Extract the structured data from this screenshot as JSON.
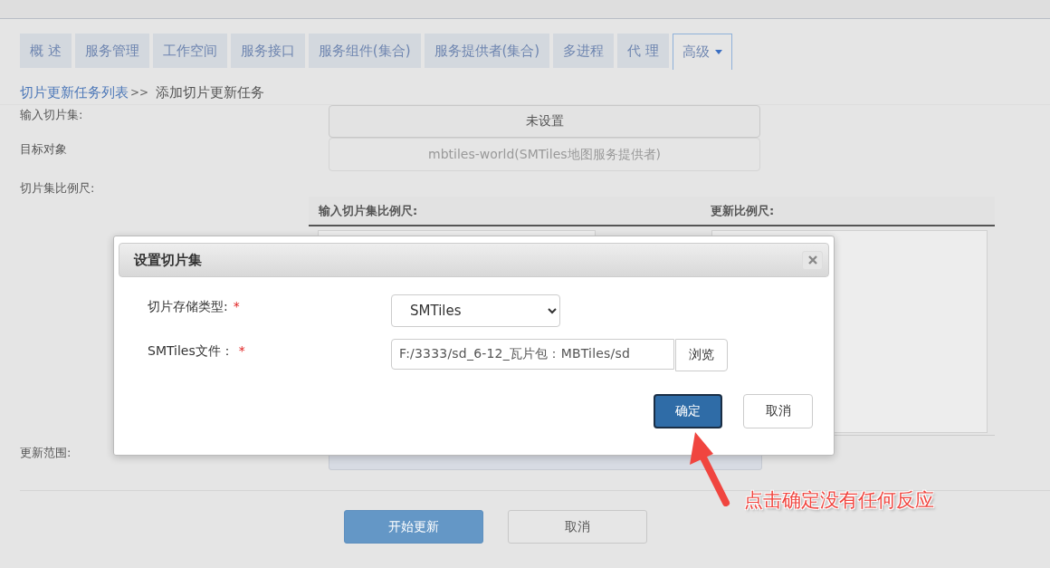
{
  "tabs": [
    {
      "label": "概 述",
      "selected": false,
      "kind": "plain"
    },
    {
      "label": "服务管理",
      "selected": false,
      "kind": "plain"
    },
    {
      "label": "工作空间",
      "selected": false,
      "kind": "plain"
    },
    {
      "label": "服务接口",
      "selected": false,
      "kind": "plain"
    },
    {
      "label": "服务组件(集合)",
      "selected": false,
      "kind": "plain"
    },
    {
      "label": "服务提供者(集合)",
      "selected": false,
      "kind": "plain"
    },
    {
      "label": "多进程",
      "selected": false,
      "kind": "plain"
    },
    {
      "label": "代 理",
      "selected": false,
      "kind": "plain"
    },
    {
      "label": "高级",
      "selected": true,
      "kind": "dropdown"
    }
  ],
  "breadcrumb": {
    "link": "切片更新任务列表",
    "separator": ">>",
    "current": "添加切片更新任务"
  },
  "form": {
    "input_tileset": {
      "label": "输入切片集:",
      "button": "未设置"
    },
    "target": {
      "label": "目标对象",
      "value": "mbtiles-world(SMTiles地图服务提供者)"
    },
    "scales": {
      "label": "切片集比例尺:",
      "columns": [
        "输入切片集比例尺:",
        "更新比例尺:"
      ]
    },
    "update_range": {
      "label": "更新范围:"
    }
  },
  "actions": [
    "开始更新",
    "取消"
  ],
  "dialog": {
    "title": "设置切片集",
    "fields": [
      {
        "kind": "select",
        "label": "切片存储类型:",
        "required_mark": "*",
        "value": "SMTiles"
      },
      {
        "kind": "file",
        "label": "SMTiles文件：",
        "required_mark": "*",
        "value": "F:/3333/sd_6-12_瓦片包：MBTiles/sd",
        "button": "浏览"
      }
    ],
    "buttons": [
      {
        "label": "确定",
        "primary": true
      },
      {
        "label": "取消",
        "primary": false
      }
    ]
  },
  "annotation": "点击确定没有任何反应"
}
